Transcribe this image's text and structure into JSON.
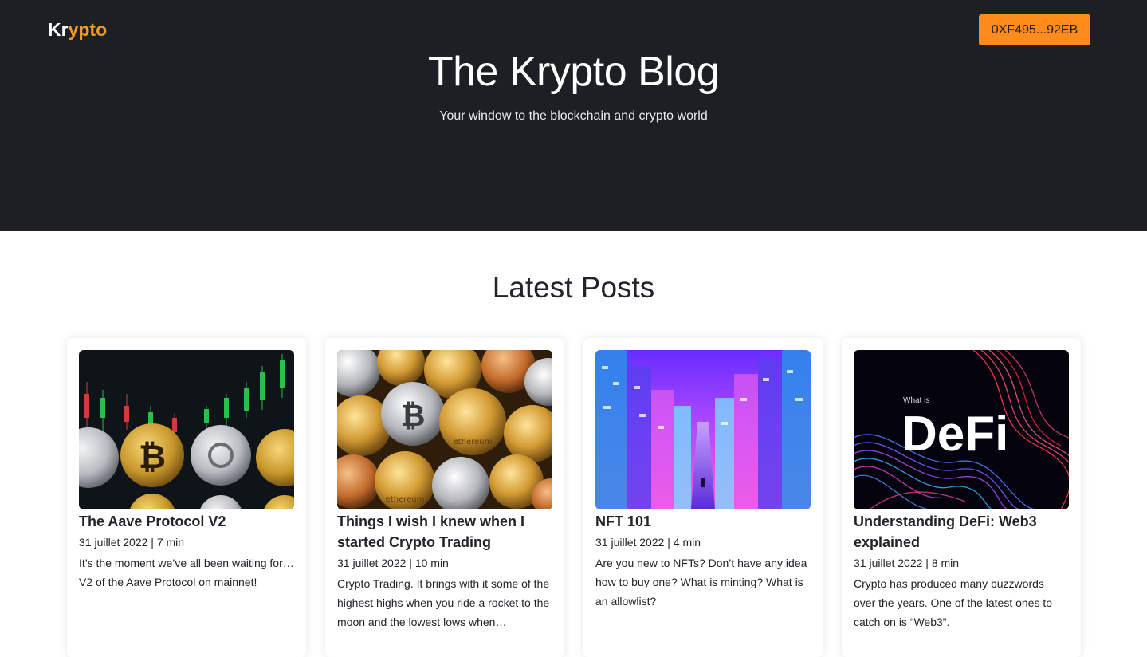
{
  "header": {
    "logo_part1": "Kr",
    "logo_part2": "ypto",
    "wallet_button": "0XF495...92EB",
    "title": "The Krypto Blog",
    "subtitle": "Your window to the blockchain and crypto world"
  },
  "section": {
    "title": "Latest Posts"
  },
  "posts": [
    {
      "title": "The Aave Protocol V2",
      "meta": "31 juillet 2022 | 7 min",
      "excerpt": "It’s the moment we’ve all been waiting for… V2 of the Aave Protocol on mainnet!"
    },
    {
      "title": "Things I wish I knew when I started Crypto Trading",
      "meta": "31 juillet 2022 | 10 min",
      "excerpt": "Crypto Trading. It brings with it some of the highest highs when you ride a rocket to the moon and the lowest lows when…"
    },
    {
      "title": "NFT 101",
      "meta": "31 juillet 2022 | 4 min",
      "excerpt": "Are you new to NFTs? Don’t have any idea how to buy one? What is minting? What is an allowlist?"
    },
    {
      "title": "Understanding DeFi: Web3 explained",
      "meta": "31 juillet 2022 | 8 min",
      "excerpt": "Crypto has produced many buzzwords over the years. One of the latest ones to catch on is “Web3”."
    }
  ],
  "images": {
    "defi_small": "What is",
    "defi_big": "DeFi",
    "ethereum_text": "ethereum"
  },
  "colors": {
    "hero_bg": "#1c1f23",
    "accent": "#fd8c1c",
    "logo_accent": "#f39a21"
  }
}
